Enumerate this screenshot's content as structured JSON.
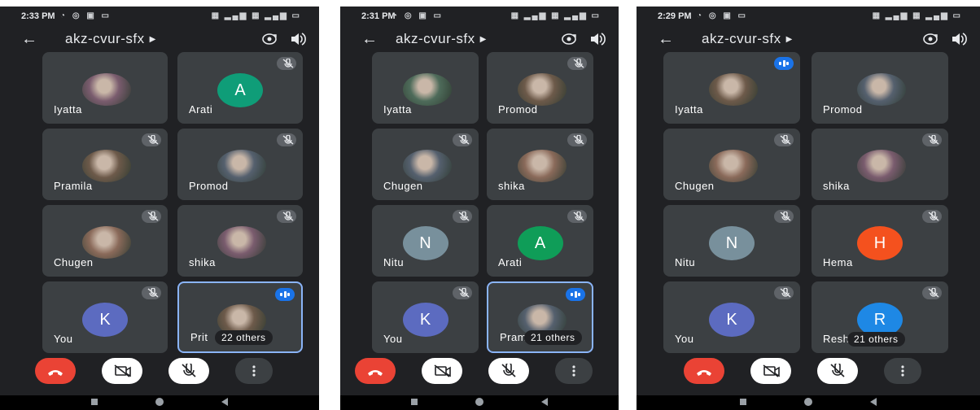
{
  "colors": {
    "background": "#202124",
    "tile": "#3c4043",
    "active_border": "#8ab4f8",
    "end_call": "#ea4335",
    "speaking_badge": "#1a73e8"
  },
  "icons": {
    "back": "arrow-left-icon",
    "title_caret": "caret-right-icon",
    "camera_switch": "camera-switch-icon",
    "speaker": "speaker-icon",
    "mic_off": "mic-off-icon",
    "speaking": "audio-levels-icon",
    "end_call": "phone-hangup-icon",
    "camera_off": "video-off-icon",
    "more": "more-vert-icon"
  },
  "screens": [
    {
      "status_time": "2:33 PM",
      "meeting_title": "akz-cvur-sfx",
      "tiles": [
        {
          "name": "Iyatta",
          "avatar": "photo",
          "muted": false
        },
        {
          "name": "Arati",
          "avatar": "A",
          "avatar_color": "#0f9d78",
          "muted": true
        },
        {
          "name": "Pramila",
          "avatar": "photo",
          "muted": true
        },
        {
          "name": "Promod",
          "avatar": "photo",
          "muted": true
        },
        {
          "name": "Chugen",
          "avatar": "photo",
          "muted": true
        },
        {
          "name": "shika",
          "avatar": "photo",
          "muted": true
        },
        {
          "name": "You",
          "avatar": "K",
          "avatar_color": "#5c6bc0",
          "muted": true
        },
        {
          "name": "Prit",
          "avatar": "photo",
          "speaking": true,
          "others": "22 others"
        }
      ]
    },
    {
      "status_time": "2:31 PM",
      "meeting_title": "akz-cvur-sfx",
      "tiles": [
        {
          "name": "Iyatta",
          "avatar": "photo",
          "muted": false
        },
        {
          "name": "Promod",
          "avatar": "photo",
          "muted": true
        },
        {
          "name": "Chugen",
          "avatar": "photo",
          "muted": true
        },
        {
          "name": "shika",
          "avatar": "photo",
          "muted": true
        },
        {
          "name": "Nitu",
          "avatar": "N",
          "avatar_color": "#78909c",
          "muted": true
        },
        {
          "name": "Arati",
          "avatar": "A",
          "avatar_color": "#0f9d58",
          "muted": true
        },
        {
          "name": "You",
          "avatar": "K",
          "avatar_color": "#5c6bc0",
          "muted": true
        },
        {
          "name": "Pram",
          "avatar": "photo",
          "speaking": true,
          "others": "21 others"
        }
      ]
    },
    {
      "status_time": "2:29 PM",
      "meeting_title": "akz-cvur-sfx",
      "tiles": [
        {
          "name": "Iyatta",
          "avatar": "photo",
          "speaking": true
        },
        {
          "name": "Promod",
          "avatar": "photo",
          "muted": false
        },
        {
          "name": "Chugen",
          "avatar": "photo",
          "muted": true
        },
        {
          "name": "shika",
          "avatar": "photo",
          "muted": true
        },
        {
          "name": "Nitu",
          "avatar": "N",
          "avatar_color": "#78909c",
          "muted": true
        },
        {
          "name": "Hema",
          "avatar": "H",
          "avatar_color": "#f4511e",
          "muted": true
        },
        {
          "name": "You",
          "avatar": "K",
          "avatar_color": "#5c6bc0",
          "muted": true
        },
        {
          "name": "Resh",
          "avatar": "R",
          "avatar_color": "#1e88e5",
          "muted": true,
          "others": "21 others"
        }
      ]
    }
  ]
}
